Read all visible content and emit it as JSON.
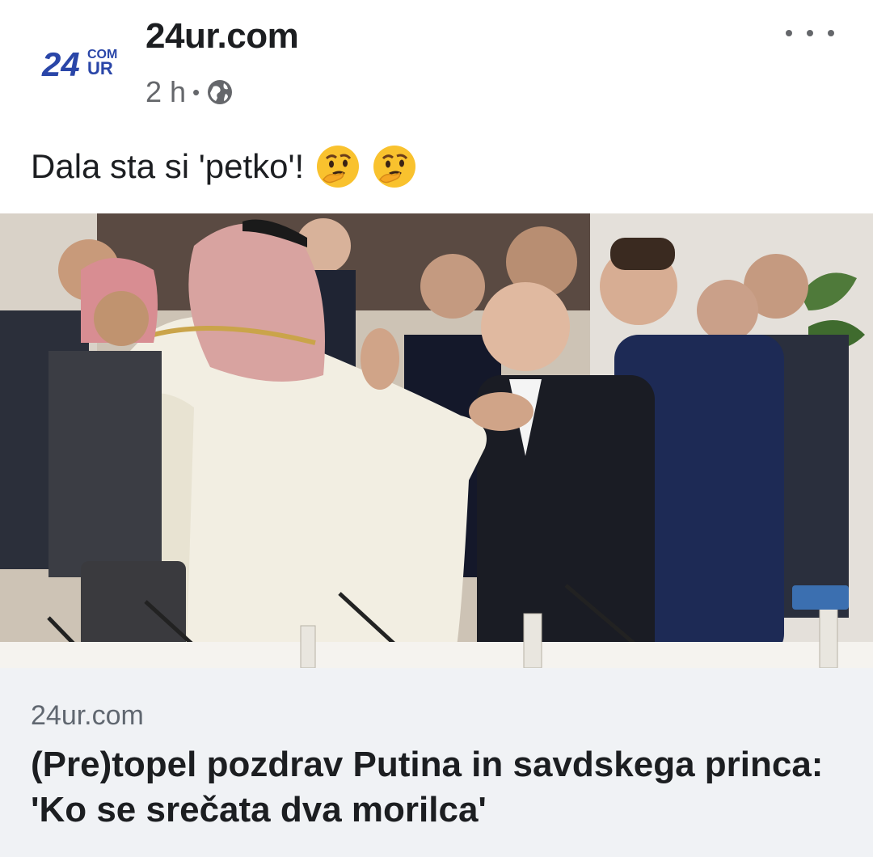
{
  "post": {
    "page_name": "24ur.com",
    "logo_text_main": "24",
    "logo_text_com": "COM",
    "logo_text_ur": "UR",
    "time": "2 h",
    "separator": "•",
    "message": "Dala sta si 'petko'!"
  },
  "link_preview": {
    "domain": "24ur.com",
    "title": "(Pre)topel pozdrav Putina in savdskega princa: 'Ko se srečata dva morilca'"
  },
  "colors": {
    "logo_blue": "#2a46a8",
    "meta_grey": "#65676b",
    "link_bg": "#f0f2f5"
  },
  "icons": [
    "globe-icon",
    "more-options-icon",
    "thinking-face-icon"
  ]
}
